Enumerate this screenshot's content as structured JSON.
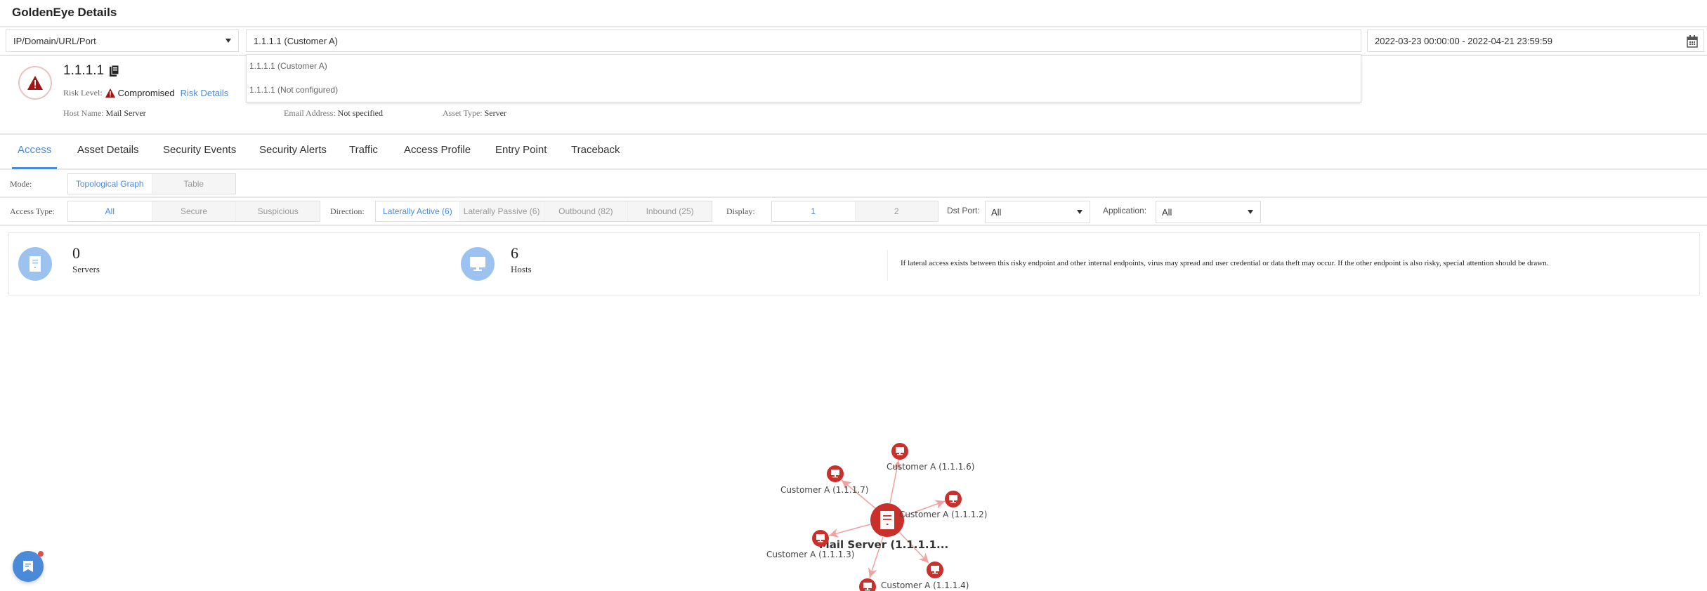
{
  "header": {
    "title": "GoldenEye Details"
  },
  "filters": {
    "type_select": "IP/Domain/URL/Port",
    "search_value": "1.1.1.1 (Customer A)",
    "date_range": "2022-03-23 00:00:00 - 2022-04-21 23:59:59"
  },
  "dropdown": {
    "options": [
      "1.1.1.1 (Customer A)",
      "1.1.1.1 (Not configured)"
    ]
  },
  "asset": {
    "ip": "1.1.1.1",
    "risk_label": "Risk Level:",
    "risk_value": "Compromised",
    "risk_details": "Risk Details",
    "host_label": "Host Name:",
    "host_value": "Mail Server",
    "email_label": "Email Address:",
    "email_value": "Not specified",
    "type_label": "Asset Type:",
    "type_value": "Server"
  },
  "tabs": [
    "Access",
    "Asset Details",
    "Security Events",
    "Security Alerts",
    "Traffic",
    "Access Profile",
    "Entry Point",
    "Traceback"
  ],
  "mode": {
    "label": "Mode:",
    "options": [
      "Topological Graph",
      "Table"
    ]
  },
  "filters2": {
    "access_label": "Access Type:",
    "access_options": [
      "All",
      "Secure",
      "Suspicious"
    ],
    "direction_label": "Direction:",
    "direction_options": [
      "Laterally Active (6)",
      "Laterally Passive (6)",
      "Outbound (82)",
      "Inbound (25)"
    ],
    "display_label": "Display:",
    "display_options": [
      "1",
      "2"
    ],
    "dst_label": "Dst Port:",
    "dst_value": "All",
    "app_label": "Application:",
    "app_value": "All"
  },
  "summary": {
    "servers_count": "0",
    "servers_label": "Servers",
    "hosts_count": "6",
    "hosts_label": "Hosts",
    "info": "If lateral access exists between this risky endpoint and other internal endpoints, virus may spread and user credential or data theft may occur. If the other endpoint is also risky, special attention should be drawn."
  },
  "graph": {
    "center": "Mail Server (1.1.1.1...",
    "nodes": [
      "Customer A (1.1.1.6)",
      "Customer A (1.1.1.7)",
      "Customer A (1.1.1.2)",
      "Customer A (1.1.1.3)",
      "Customer A (1.1.1.4)"
    ]
  },
  "colors": {
    "accent": "#4a8ad9",
    "danger": "#c9302c"
  }
}
